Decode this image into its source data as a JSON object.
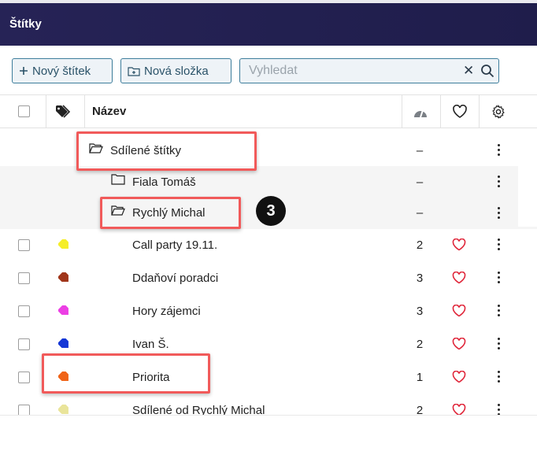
{
  "dialog": {
    "title": "Štítky"
  },
  "toolbar": {
    "new_tag_label": "Nový štítek",
    "new_folder_label": "Nová složka",
    "search_placeholder": "Vyhledat",
    "clear_symbol": "✕"
  },
  "table": {
    "name_header": "Název"
  },
  "rows": [
    {
      "kind": "folder",
      "name": "Sdílené štítky",
      "count": "–",
      "open": true
    },
    {
      "kind": "folder",
      "name": "Fiala Tomáš",
      "count": "–",
      "open": false
    },
    {
      "kind": "folder",
      "name": "Rychlý Michal",
      "count": "–",
      "open": true
    },
    {
      "kind": "tag",
      "name": "Call party 19.11.",
      "count": "2",
      "color": "#f5ee2a"
    },
    {
      "kind": "tag",
      "name": "Ddaňoví poradci",
      "count": "3",
      "color": "#a0351a"
    },
    {
      "kind": "tag",
      "name": "Hory zájemci",
      "count": "3",
      "color": "#ec3fe4"
    },
    {
      "kind": "tag",
      "name": "Ivan Š.",
      "count": "2",
      "color": "#1537d6"
    },
    {
      "kind": "tag",
      "name": "Priorita",
      "count": "1",
      "color": "#f06418"
    },
    {
      "kind": "tag",
      "name": "Sdílené od Rychlý Michal",
      "count": "2",
      "color": "#e9e49a"
    }
  ],
  "annotation": {
    "badge_number": "3"
  },
  "colors": {
    "titlebar": "#262356",
    "accent": "#3d7d9b",
    "heart": "#e0263a",
    "highlight": "#f15a5a"
  }
}
